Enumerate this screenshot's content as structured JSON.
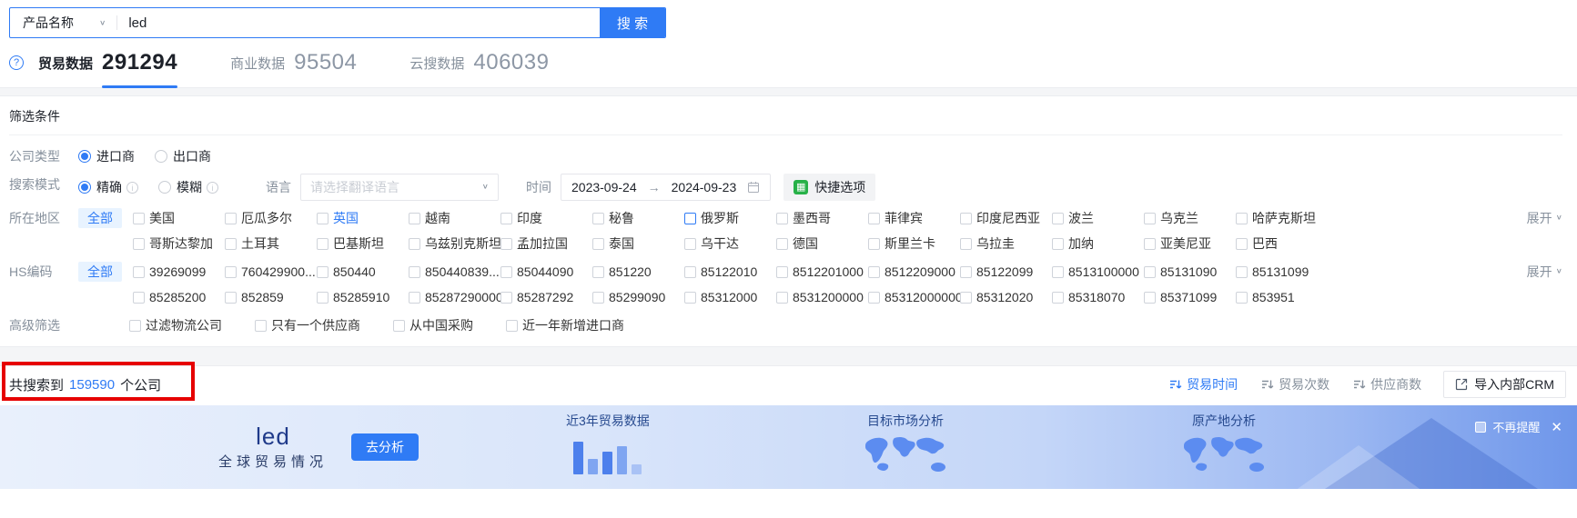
{
  "colors": {
    "accent": "#2f7bf5",
    "annotation_red": "#e60000",
    "quick_icon_green": "#27b148"
  },
  "search": {
    "category": "产品名称",
    "query": "led",
    "button": "搜 索"
  },
  "tabs": [
    {
      "label": "贸易数据",
      "count": "291294",
      "active": true
    },
    {
      "label": "商业数据",
      "count": "95504",
      "active": false
    },
    {
      "label": "云搜数据",
      "count": "406039",
      "active": false
    }
  ],
  "filters": {
    "title": "筛选条件",
    "company_type_label": "公司类型",
    "company_type": [
      {
        "label": "进口商",
        "selected": true
      },
      {
        "label": "出口商",
        "selected": false
      }
    ],
    "search_mode_label": "搜索模式",
    "search_mode": [
      {
        "label": "精确",
        "selected": true
      },
      {
        "label": "模糊",
        "selected": false
      }
    ],
    "language_label": "语言",
    "language_placeholder": "请选择翻译语言",
    "time_label": "时间",
    "time_start": "2023-09-24",
    "time_arrow": "→",
    "time_end": "2024-09-23",
    "quick_options": "快捷选项",
    "region_label": "所在地区",
    "region_all": "全部",
    "region_items": [
      "美国",
      "厄瓜多尔",
      {
        "label": "英国",
        "cls": "hl-text"
      },
      "越南",
      "印度",
      "秘鲁",
      {
        "label": "俄罗斯",
        "cls": "hl-box"
      },
      "墨西哥",
      "菲律宾",
      "印度尼西亚",
      "波兰",
      "乌克兰",
      "哈萨克斯坦",
      "哥斯达黎加",
      "土耳其",
      "巴基斯坦",
      "乌兹别克斯坦",
      "孟加拉国",
      "泰国",
      "乌干达",
      "德国",
      "斯里兰卡",
      "乌拉圭",
      "加纳",
      "亚美尼亚",
      "巴西"
    ],
    "region_expand": "展开",
    "hs_label": "HS编码",
    "hs_all": "全部",
    "hs_items": [
      "39269099",
      "760429900...",
      "850440",
      "850440839...",
      "85044090",
      "851220",
      "85122010",
      "8512201000",
      "8512209000",
      "85122099",
      "8513100000",
      "85131090",
      "85131099",
      "85285200",
      "852859",
      "85285910",
      "85287290000",
      "85287292",
      "85299090",
      "85312000",
      "8531200000",
      "85312000000",
      "85312020",
      "85318070",
      "85371099",
      "853951"
    ],
    "hs_expand": "展开",
    "advanced_label": "高级筛选",
    "advanced_items": [
      "过滤物流公司",
      "只有一个供应商",
      "从中国采购",
      "近一年新增进口商"
    ]
  },
  "results": {
    "prefix": "共搜索到",
    "count": "159590",
    "suffix": "个公司",
    "sorts": [
      {
        "label": "贸易时间",
        "cls": "active"
      },
      {
        "label": "贸易次数"
      },
      {
        "label": "供应商数"
      }
    ],
    "crm_button": "导入内部CRM"
  },
  "banner": {
    "keyword": "led",
    "subtitle": "全球贸易情况",
    "analyze": "去分析",
    "feature_trade": "近3年贸易数据",
    "feature_market": "目标市场分析",
    "feature_origin": "原产地分析",
    "dismiss": "不再提醒"
  }
}
